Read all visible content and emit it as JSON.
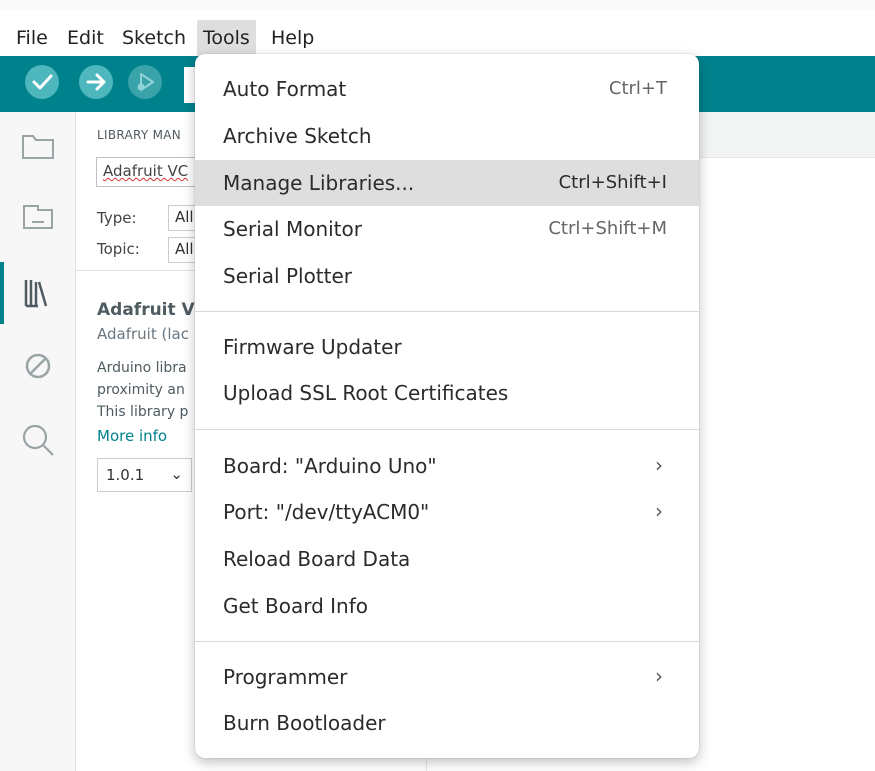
{
  "menubar": {
    "items": [
      {
        "label": "File"
      },
      {
        "label": "Edit"
      },
      {
        "label": "Sketch"
      },
      {
        "label": "Tools"
      },
      {
        "label": "Help"
      }
    ],
    "active": "Tools"
  },
  "toolbar": {
    "verify_icon": "checkmark-icon",
    "upload_icon": "arrow-right-icon",
    "debug_icon": "debug-icon"
  },
  "library_panel": {
    "title": "LIBRARY MAN",
    "search_value": "Adafruit VC",
    "type_label": "Type:",
    "type_value": "All",
    "topic_label": "Topic:",
    "topic_value": "All",
    "item": {
      "name": "Adafruit V",
      "author": "Adafruit (lac",
      "description_lines": [
        "Arduino libra",
        "proximity an",
        "This library p"
      ],
      "more_info": "More info",
      "version": "1.0.1"
    }
  },
  "tools_menu": {
    "items": [
      {
        "label": "Auto Format",
        "shortcut": "Ctrl+T"
      },
      {
        "label": "Archive Sketch",
        "shortcut": ""
      },
      {
        "label": "Manage Libraries...",
        "shortcut": "Ctrl+Shift+I",
        "highlighted": true
      },
      {
        "label": "Serial Monitor",
        "shortcut": "Ctrl+Shift+M"
      },
      {
        "label": "Serial Plotter",
        "shortcut": ""
      },
      {
        "label": "Firmware Updater",
        "shortcut": ""
      },
      {
        "label": "Upload SSL Root Certificates",
        "shortcut": ""
      },
      {
        "label": "Board: \"Arduino Uno\"",
        "submenu": true
      },
      {
        "label": "Port: \"/dev/ttyACM0\"",
        "submenu": true
      },
      {
        "label": "Reload Board Data",
        "shortcut": ""
      },
      {
        "label": "Get Board Info",
        "shortcut": ""
      },
      {
        "label": "Programmer",
        "submenu": true
      },
      {
        "label": "Burn Bootloader",
        "shortcut": ""
      }
    ],
    "submenu_glyph": "›"
  },
  "colors": {
    "accent": "#00828d",
    "highlight": "#dedede"
  }
}
